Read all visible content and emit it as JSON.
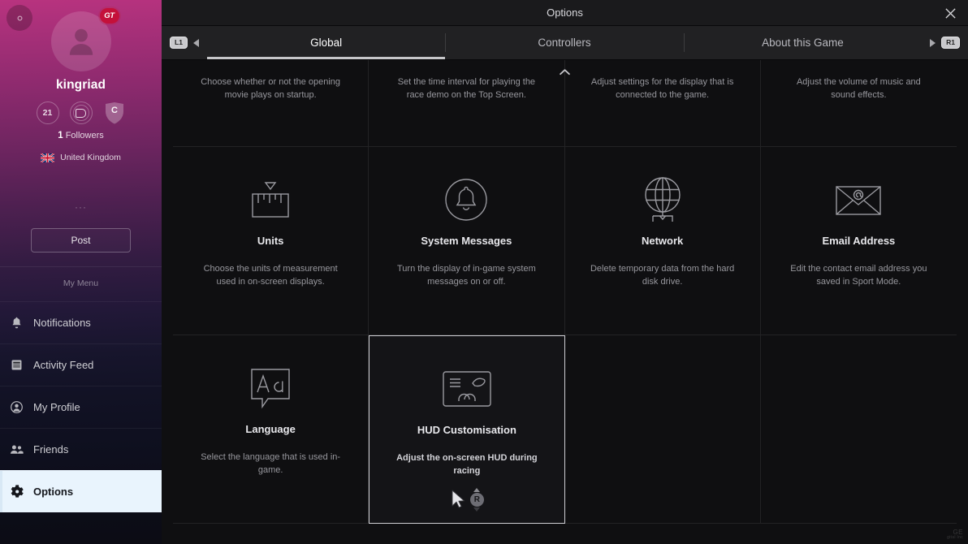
{
  "window": {
    "title": "Options",
    "close_label": "✕"
  },
  "sidebar": {
    "gear_icon": "gear-icon",
    "avatar_icon": "person-avatar-icon",
    "gt_badge": "GT",
    "username": "kingriad",
    "badges": [
      {
        "name": "level-badge",
        "value": "21"
      },
      {
        "name": "driver-rating-badge",
        "value": "D"
      },
      {
        "name": "sportsmanship-rating-badge",
        "value": "C"
      }
    ],
    "followers_count": "1",
    "followers_label": "Followers",
    "country": "United Kingdom",
    "country_flag_icon": "uk-flag-icon",
    "more_dots": "···",
    "post_label": "Post",
    "my_menu_label": "My Menu",
    "items": [
      {
        "label": "Notifications",
        "icon": "bell-icon",
        "active": false
      },
      {
        "label": "Activity Feed",
        "icon": "feed-icon",
        "active": false
      },
      {
        "label": "My Profile",
        "icon": "profile-icon",
        "active": false
      },
      {
        "label": "Friends",
        "icon": "friends-icon",
        "active": false
      },
      {
        "label": "Options",
        "icon": "gear-icon",
        "active": true
      }
    ]
  },
  "tabbar": {
    "left_button": "L1",
    "right_button": "R1",
    "tabs": [
      {
        "label": "Global",
        "active": true
      },
      {
        "label": "Controllers",
        "active": false
      },
      {
        "label": "About this Game",
        "active": false
      }
    ]
  },
  "scroll_up_icon": "chevron-up-icon",
  "grid": {
    "row1": [
      {
        "name": "opening-movie",
        "desc": "Choose whether or not the opening movie plays on startup."
      },
      {
        "name": "race-demo",
        "desc": "Set the time interval for playing the race demo on the Top Screen."
      },
      {
        "name": "display-settings",
        "desc": "Adjust settings for the display that is connected to the game."
      },
      {
        "name": "volume-settings",
        "desc": "Adjust the volume of music and sound effects."
      }
    ],
    "row2": [
      {
        "name": "units",
        "icon": "ruler-icon",
        "title": "Units",
        "desc": "Choose the units of measurement used in on-screen displays.",
        "selected": false
      },
      {
        "name": "system-messages",
        "icon": "bell-circle-icon",
        "title": "System Messages",
        "desc": "Turn the display of in-game system messages on or off.",
        "selected": false
      },
      {
        "name": "network",
        "icon": "globe-network-icon",
        "title": "Network",
        "desc": "Delete temporary data from the hard disk drive.",
        "selected": false
      },
      {
        "name": "email-address",
        "icon": "envelope-at-icon",
        "title": "Email Address",
        "desc": "Edit the contact email address you saved in Sport Mode.",
        "selected": false
      }
    ],
    "row3": [
      {
        "name": "language",
        "icon": "speech-bubble-aa-icon",
        "title": "Language",
        "desc": "Select the language that is used in-game.",
        "selected": false
      },
      {
        "name": "hud-customisation",
        "icon": "hud-screen-icon",
        "title": "HUD Customisation",
        "desc": "Adjust the on-screen HUD during racing",
        "selected": true
      },
      {
        "name": "empty-cell-1",
        "icon": "",
        "title": "",
        "desc": "",
        "selected": false
      },
      {
        "name": "empty-cell-2",
        "icon": "",
        "title": "",
        "desc": "",
        "selected": false
      }
    ]
  },
  "hud_hint": {
    "cursor_icon": "mouse-cursor-icon",
    "wheel_label": "R"
  },
  "watermark": {
    "line1": "GE",
    "line2": "gital Inc"
  },
  "colors": {
    "accent_pink": "#b8337f",
    "selected_tile_border": "#cfcfd4",
    "active_nav_bg": "#e9f4fd",
    "gt_badge_red": "#c4103a"
  }
}
